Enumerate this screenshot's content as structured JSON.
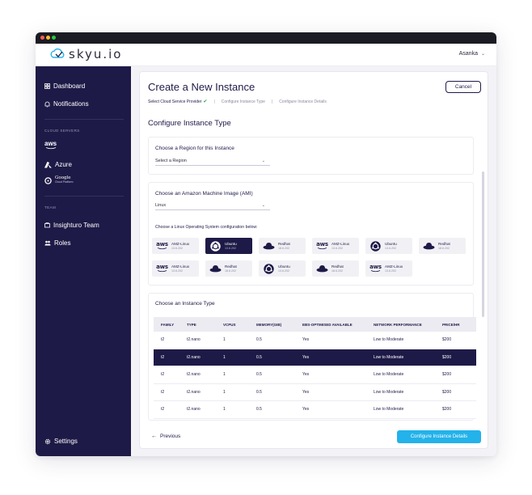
{
  "colors": {
    "sidebar_bg": "#1e1a47",
    "accent": "#23b2ea",
    "success": "#2aa44f",
    "window_dots": [
      "#ff5f57",
      "#febc2e",
      "#28c840"
    ]
  },
  "topbar": {
    "logo_text": "skyu.io",
    "user_name": "Asanka"
  },
  "sidebar": {
    "items": [
      {
        "label": "Dashboard",
        "icon": "grid-icon"
      },
      {
        "label": "Notifications",
        "icon": "bell-icon"
      }
    ],
    "cloud_section": "CLOUD SERVERS",
    "cloud_items": [
      {
        "label": "aws",
        "icon": "aws-logo"
      },
      {
        "label": "Azure",
        "icon": "azure-logo"
      },
      {
        "label": "Google",
        "sub": "Cloud Platform",
        "icon": "google-cloud-logo"
      }
    ],
    "team_section": "TEAM",
    "team_items": [
      {
        "label": "Insighturo Team",
        "icon": "team-icon"
      },
      {
        "label": "Roles",
        "icon": "roles-icon"
      }
    ],
    "settings_label": "Settings"
  },
  "main": {
    "title": "Create a New Instance",
    "cancel_label": "Cancel",
    "steps": [
      "Select Cloud Service Provider",
      "Configure Instance Type",
      "Configure Instance Details"
    ],
    "section_title": "Configure Instance Type",
    "region": {
      "label": "Choose a Region for this Instance",
      "value": "Select a Region"
    },
    "ami": {
      "label": "Choose an Amazon Machine Image (AMI)",
      "value": "Linux",
      "os_prompt": "Choose a Linux Operating System configuration below:",
      "os_options": [
        {
          "name": "AMZ-Linux",
          "version": "13.6.202",
          "icon": "aws-logo",
          "selected": false
        },
        {
          "name": "Ubuntu",
          "version": "13.6.202",
          "icon": "ubuntu-icon",
          "selected": true
        },
        {
          "name": "Redhat",
          "version": "18.6.202",
          "icon": "redhat-icon",
          "selected": false
        },
        {
          "name": "AMZ-Linux",
          "version": "13.6.202",
          "icon": "aws-logo",
          "selected": false
        },
        {
          "name": "Ubuntu",
          "version": "13.6.202",
          "icon": "ubuntu-icon",
          "selected": false
        },
        {
          "name": "Redhat",
          "version": "18.6.202",
          "icon": "redhat-icon",
          "selected": false
        },
        {
          "name": "AMZ-Linux",
          "version": "13.6.202",
          "icon": "aws-logo",
          "selected": false
        },
        {
          "name": "Redhat",
          "version": "18.6.202",
          "icon": "redhat-icon",
          "selected": false
        },
        {
          "name": "Ubuntu",
          "version": "13.6.202",
          "icon": "ubuntu-icon",
          "selected": false
        },
        {
          "name": "Redhat",
          "version": "18.6.202",
          "icon": "redhat-icon",
          "selected": false
        },
        {
          "name": "AMZ-Linux",
          "version": "13.6.202",
          "icon": "aws-logo",
          "selected": false
        }
      ]
    },
    "instance_type": {
      "label": "Choose an Instance Type",
      "columns": [
        "FAMILY",
        "TYPE",
        "VCPUS",
        "MEMORY(GIB)",
        "EBS-OPTIMISED AVAILABLE",
        "NETWORK PERFORMANCE",
        "PRICE/HR"
      ],
      "rows": [
        [
          "t2",
          "t2.nano",
          "1",
          "0.5",
          "Yes",
          "Low to Moderate",
          "$200"
        ],
        [
          "t2",
          "t2.nano",
          "1",
          "0.5",
          "Yes",
          "Low to Moderate",
          "$200"
        ],
        [
          "t2",
          "t2.nano",
          "1",
          "0.5",
          "Yes",
          "Low to Moderate",
          "$200"
        ],
        [
          "t2",
          "t2.nano",
          "1",
          "0.5",
          "Yes",
          "Low to Moderate",
          "$200"
        ],
        [
          "t2",
          "t2.nano",
          "1",
          "0.5",
          "Yes",
          "Low to Moderate",
          "$200"
        ]
      ],
      "selected_row": 1
    },
    "previous_label": "Previous",
    "next_label": "Configure Instance Details"
  }
}
